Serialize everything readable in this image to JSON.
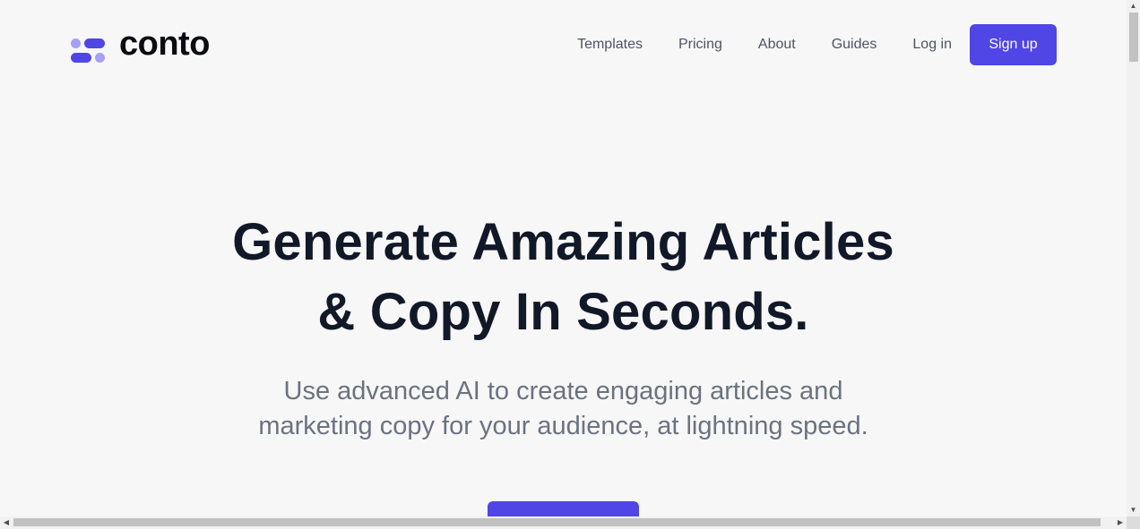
{
  "brand": {
    "name": "conto",
    "colors": {
      "accent": "#4f46e5",
      "accent_light": "#a5a0f5",
      "text_dark": "#111827",
      "text_muted": "#6b7280",
      "background": "#f7f7f8"
    }
  },
  "nav": {
    "links": [
      {
        "label": "Templates"
      },
      {
        "label": "Pricing"
      },
      {
        "label": "About"
      },
      {
        "label": "Guides"
      }
    ],
    "login_label": "Log in",
    "signup_label": "Sign up"
  },
  "hero": {
    "title_lines": [
      "Generate Amazing Articles",
      "& Copy In Seconds."
    ],
    "subtitle_lines": [
      "Use advanced AI to create engaging articles and",
      "marketing copy for your audience, at lightning speed."
    ],
    "cta_label": ""
  },
  "scrollbars": {
    "vertical": {
      "up_icon": "triangle-up-icon",
      "down_icon": "triangle-down-icon"
    },
    "horizontal": {
      "left_icon": "triangle-left-icon",
      "right_icon": "triangle-right-icon"
    }
  }
}
